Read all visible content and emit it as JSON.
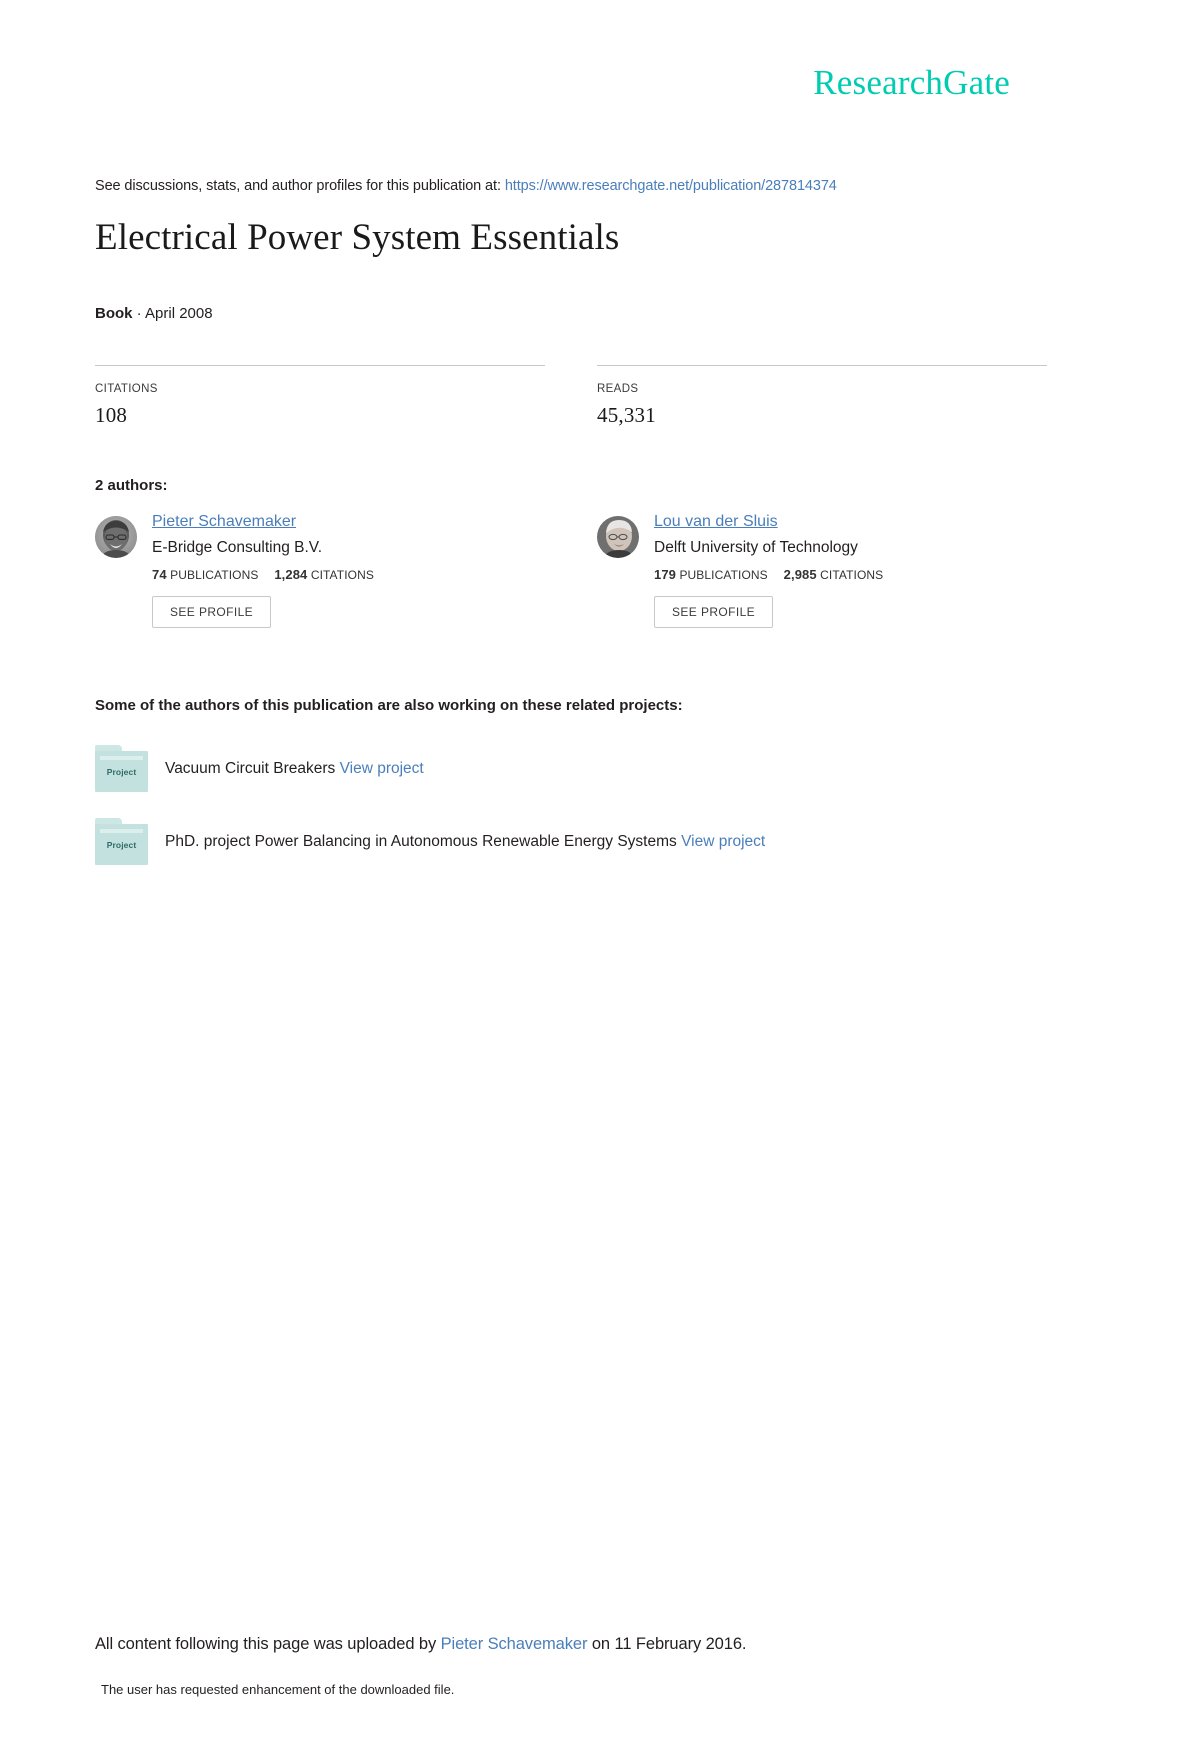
{
  "brand": {
    "logo_text": "ResearchGate",
    "logo_color": "#00ccb1",
    "link_color": "#4a7ebb"
  },
  "header": {
    "discussions_prefix": "See discussions, stats, and author profiles for this publication at:",
    "publication_url": "https://www.researchgate.net/publication/287814374"
  },
  "publication": {
    "title": "Electrical Power System Essentials",
    "type": "Book",
    "type_separator": "·",
    "date": "April 2008"
  },
  "metrics": [
    {
      "label": "CITATIONS",
      "value": "108"
    },
    {
      "label": "READS",
      "value": "45,331"
    }
  ],
  "authors_section": {
    "heading": "2 authors:",
    "see_profile_label": "SEE PROFILE",
    "publications_label": "PUBLICATIONS",
    "citations_label": "CITATIONS",
    "authors": [
      {
        "name": "Pieter Schavemaker",
        "affiliation": "E-Bridge Consulting B.V.",
        "publications": "74",
        "citations": "1,284"
      },
      {
        "name": "Lou van der Sluis",
        "affiliation": "Delft University of Technology",
        "publications": "179",
        "citations": "2,985"
      }
    ]
  },
  "projects_section": {
    "heading": "Some of the authors of this publication are also working on these related projects:",
    "icon_label": "Project",
    "view_project_label": "View project",
    "projects": [
      {
        "title": "Vacuum Circuit Breakers"
      },
      {
        "title": "PhD. project Power Balancing in Autonomous Renewable Energy Systems"
      }
    ]
  },
  "footer": {
    "upload_prefix": "All content following this page was uploaded by",
    "uploader": "Pieter Schavemaker",
    "upload_suffix": "on 11 February 2016.",
    "enhancement_note": "The user has requested enhancement of the downloaded file."
  }
}
